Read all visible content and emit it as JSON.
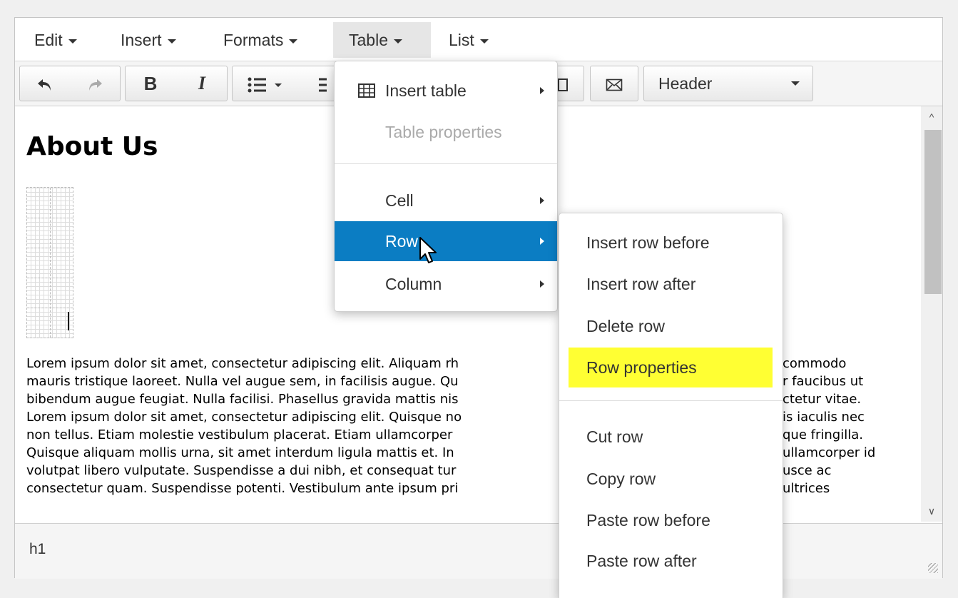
{
  "menubar": {
    "items": [
      "Edit",
      "Insert",
      "Formats",
      "Table",
      "List"
    ],
    "active": "Table"
  },
  "toolbar": {
    "undo_icon": "undo-icon",
    "redo_icon": "redo-icon",
    "bold_label": "B",
    "italic_label": "I",
    "header_select": "Header"
  },
  "content": {
    "heading": "About Us",
    "paragraph_lines": [
      "Lorem ipsum dolor sit amet, consectetur adipiscing elit. Aliquam rh",
      "mauris tristique laoreet. Nulla vel augue sem, in facilisis augue. Qu",
      "bibendum augue feugiat. Nulla facilisi. Phasellus gravida mattis nis",
      "Lorem ipsum dolor sit amet, consectetur adipiscing elit. Quisque no",
      "non tellus. Etiam molestie vestibulum placerat. Etiam ullamcorper",
      "Quisque aliquam mollis urna, sit amet interdum ligula mattis et. In",
      "volutpat libero vulputate. Suspendisse a dui nibh, et consequat tur",
      "consectetur quam. Suspendisse potenti. Vestibulum ante ipsum pri"
    ],
    "paragraph_right": [
      "commodo",
      "r faucibus ut",
      "ctetur vitae.",
      "is iaculis nec",
      "que fringilla.",
      "ullamcorper id",
      "usce ac",
      "ultrices"
    ]
  },
  "statusbar": {
    "path": "h1"
  },
  "table_menu": {
    "items": [
      {
        "label": "Insert table",
        "submenu": true,
        "icon": "table-grid-icon"
      },
      {
        "label": "Table properties",
        "disabled": true
      },
      {
        "label": "Cell",
        "submenu": true
      },
      {
        "label": "Row",
        "submenu": true,
        "selected": true
      },
      {
        "label": "Column",
        "submenu": true
      }
    ]
  },
  "row_menu": {
    "items": [
      {
        "label": "Insert row before"
      },
      {
        "label": "Insert row after"
      },
      {
        "label": "Delete row"
      },
      {
        "label": "Row properties",
        "highlight": "#ffff33"
      },
      {
        "label": "Cut row"
      },
      {
        "label": "Copy row"
      },
      {
        "label": "Paste row before"
      },
      {
        "label": "Paste row after"
      }
    ]
  },
  "colors": {
    "selected_bg": "#0b7dc3",
    "highlight_bg": "#ffff33"
  }
}
